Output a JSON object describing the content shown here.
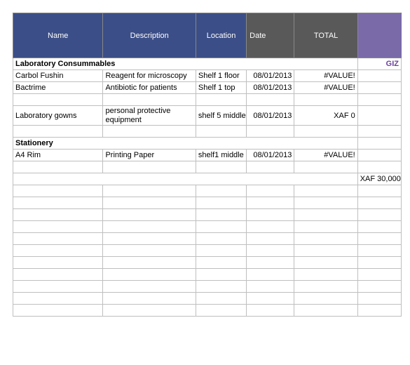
{
  "header": {
    "name": "Name",
    "description": "Description",
    "location": "Location",
    "date": "Date",
    "total": "TOTAL",
    "extra": ""
  },
  "sections": [
    {
      "title": "Laboratory Consummables",
      "right_label": "GIZ",
      "rows": [
        {
          "name": "Carbol Fushin",
          "description": "Reagent for microscopy",
          "location": "Shelf 1 floor",
          "date": "08/01/2013",
          "total": "#VALUE!",
          "extra": ""
        },
        {
          "name": "Bactrime",
          "description": "Antibiotic for patients",
          "location": "Shelf 1 top",
          "date": "08/01/2013",
          "total": "#VALUE!",
          "extra": ""
        },
        {
          "name": "",
          "description": "",
          "location": "",
          "date": "",
          "total": "",
          "extra": ""
        },
        {
          "name": "Laboratory gowns",
          "description": "personal protective equipment",
          "location": "shelf 5 middle",
          "date": "08/01/2013",
          "total": "XAF 0",
          "extra": "",
          "tall": true
        },
        {
          "name": "",
          "description": "",
          "location": "",
          "date": "",
          "total": "",
          "extra": ""
        }
      ]
    },
    {
      "title": "Stationery",
      "right_label": "",
      "rows": [
        {
          "name": "A4 Rim",
          "description": "Printing Paper",
          "location": "shelf1 middle",
          "date": "08/01/2013",
          "total": "#VALUE!",
          "extra": ""
        },
        {
          "name": "",
          "description": "",
          "location": "",
          "date": "",
          "total": "",
          "extra": ""
        }
      ]
    }
  ],
  "summary": {
    "total": "XAF 30,000"
  },
  "blank_rows": 11
}
